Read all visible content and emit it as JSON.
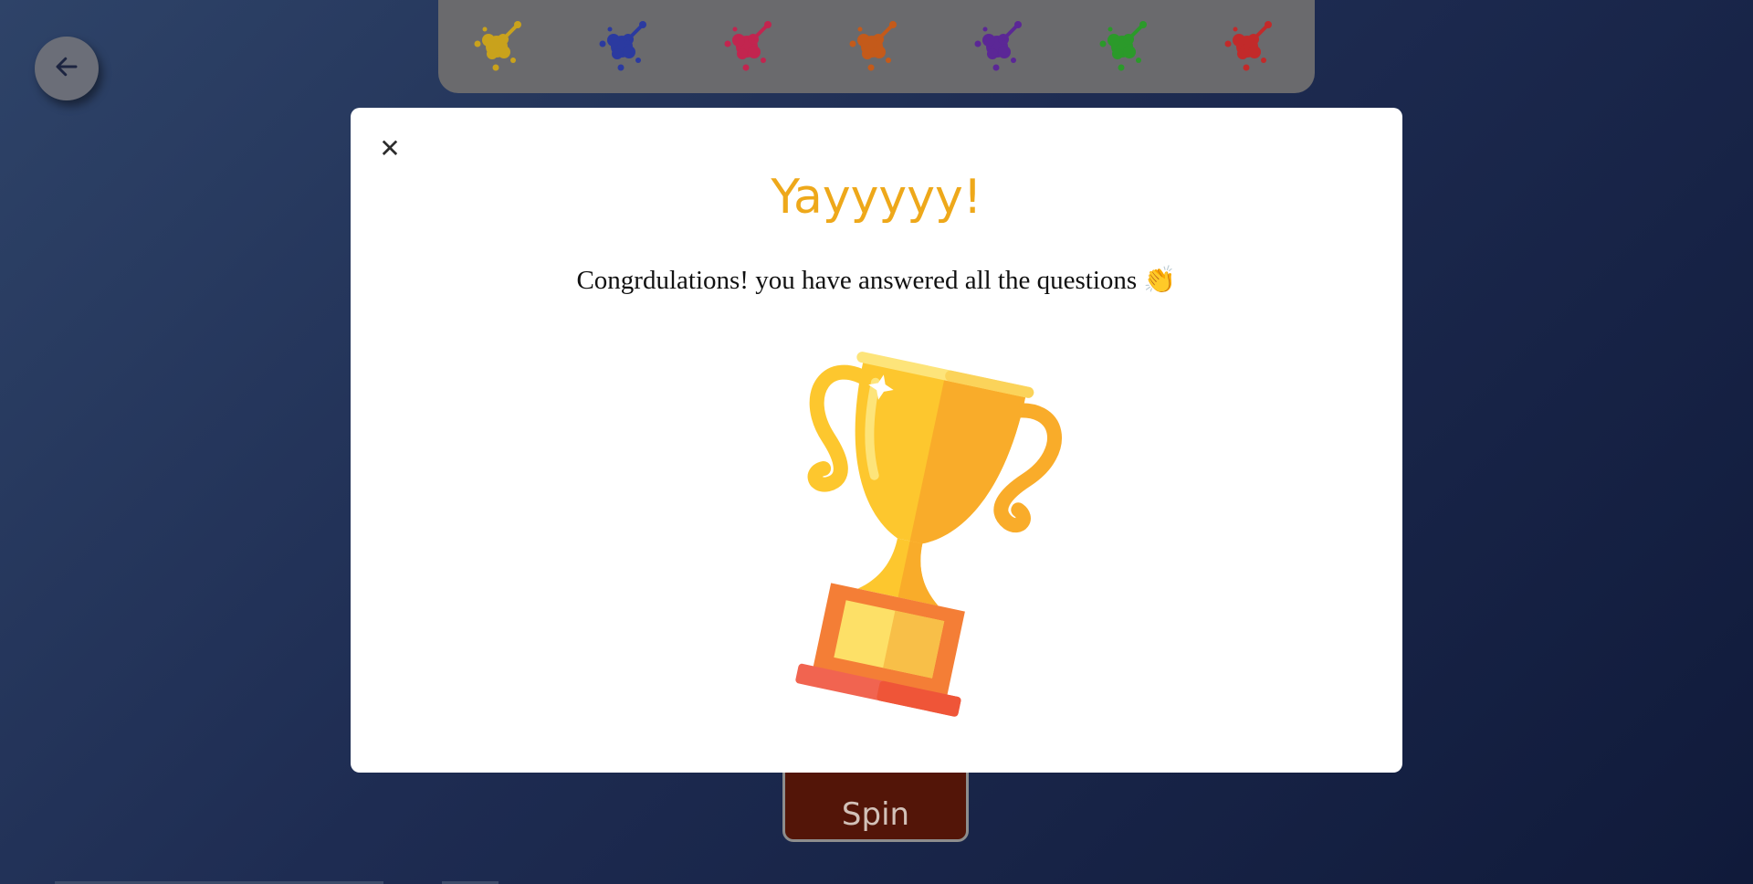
{
  "navigation": {
    "back_icon": "arrow-left-icon"
  },
  "splat_bar": {
    "splats": [
      {
        "name": "yellow",
        "color": "#c9a21c"
      },
      {
        "name": "blue",
        "color": "#2b3aa0"
      },
      {
        "name": "pink",
        "color": "#c2254f"
      },
      {
        "name": "orange",
        "color": "#c45a1a"
      },
      {
        "name": "purple",
        "color": "#5b2796"
      },
      {
        "name": "green",
        "color": "#2b9a2a"
      },
      {
        "name": "red",
        "color": "#c22a2a"
      }
    ]
  },
  "spin": {
    "label": "Spin"
  },
  "modal": {
    "close_icon": "close-icon",
    "title": "Yayyyyy!",
    "message": "Congrdulations! you have answered all the questions 👏",
    "image": "trophy-icon",
    "colors": {
      "title": "#eea81a",
      "cup_light": "#fdc72e",
      "cup_dark": "#f9ac2a",
      "base": "#f47e36"
    }
  }
}
